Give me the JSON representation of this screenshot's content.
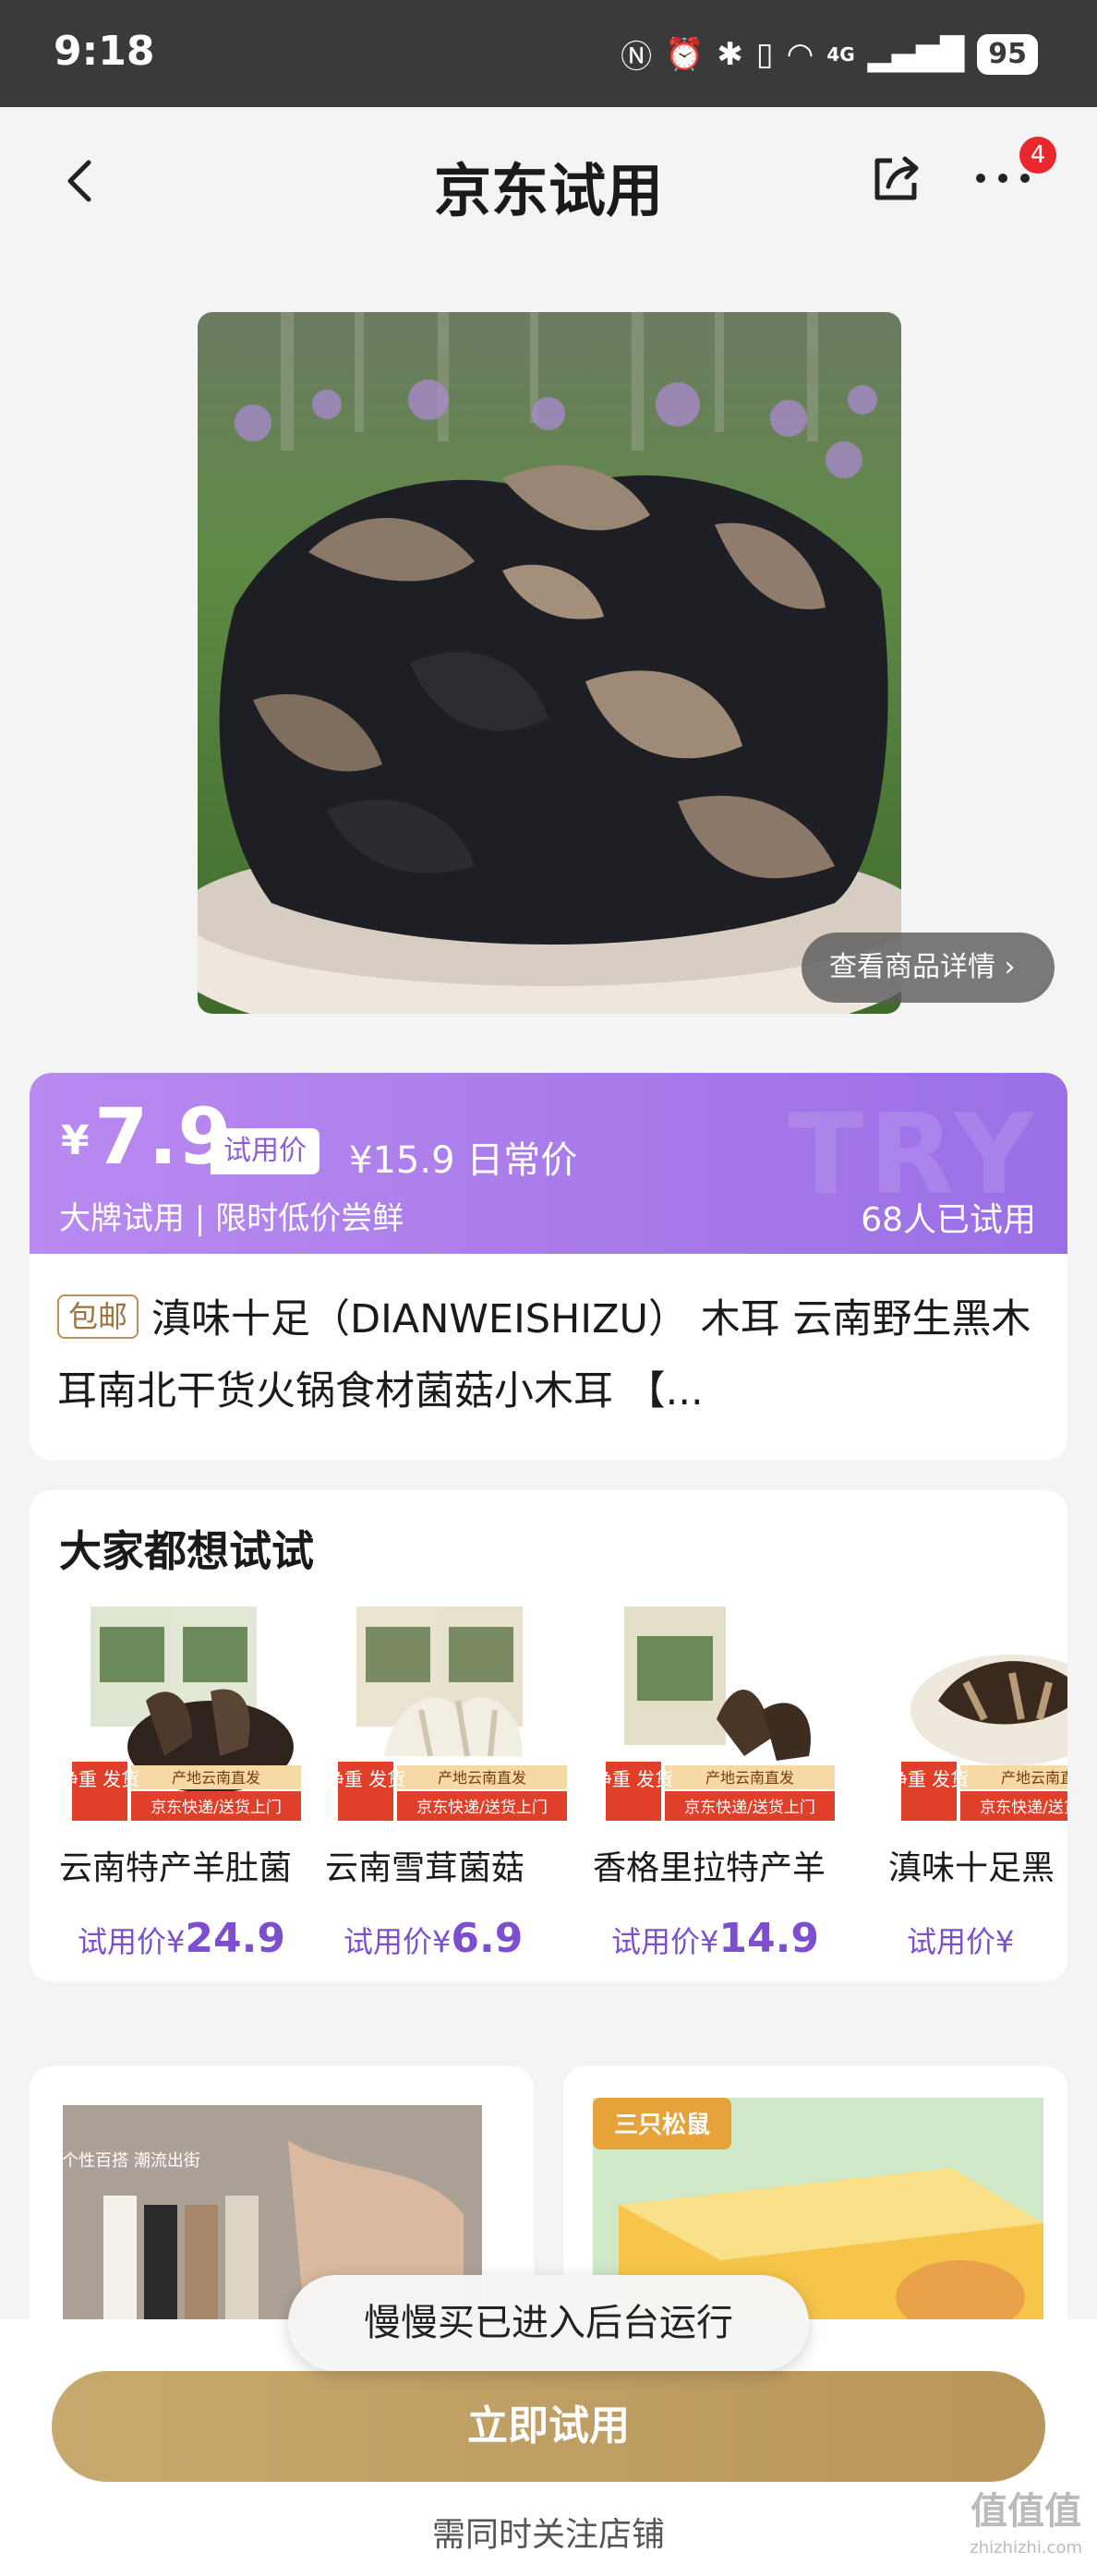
{
  "status_bar": {
    "time": "9:18",
    "battery": "95",
    "network": "4G"
  },
  "header": {
    "title": "京东试用",
    "badge_count": "4"
  },
  "product_image": {
    "detail_label": "查看商品详情 ›"
  },
  "price_banner": {
    "currency": "¥",
    "price": "7.9",
    "trial_tag": "试用价",
    "regular_price": "¥15.9 日常价",
    "slogan": "大牌试用 | 限时低价尝鲜",
    "tried_count": "68人已试用",
    "watermark": "TRY"
  },
  "product": {
    "free_shipping": "包邮",
    "title": "滇味十足（DIANWEISHIZU） 木耳 云南野生黑木耳南北干货火锅食材菌菇小木耳 【..."
  },
  "recommendations": {
    "title": "大家都想试试",
    "thumb_badges": {
      "left": "净重\n发货",
      "origin": "产地云南直发",
      "delivery": "京东快递/送货上门"
    },
    "items": [
      {
        "name": "云南特产羊肚菌",
        "price_label": "试用价¥",
        "price": "24.9"
      },
      {
        "name": "云南雪茸菌菇",
        "price_label": "试用价¥",
        "price": "6.9"
      },
      {
        "name": "香格里拉特产羊",
        "price_label": "试用价¥",
        "price": "14.9"
      },
      {
        "name": "滇味十足黑",
        "price_label": "试用价¥",
        "price": ""
      }
    ]
  },
  "feed": {
    "right_brand": "三只松鼠",
    "left_text": "个性百搭 潮流出街"
  },
  "toast": "慢慢买已进入后台运行",
  "bottom": {
    "trial_button": "立即试用",
    "follow_note": "需同时关注店铺",
    "site_mark": "值值值",
    "site_url": "zhizhizhi.com"
  },
  "colors": {
    "accent_purple": "#9b6fe6",
    "gold_button": "#c0a066",
    "badge_red": "#e8272f"
  }
}
